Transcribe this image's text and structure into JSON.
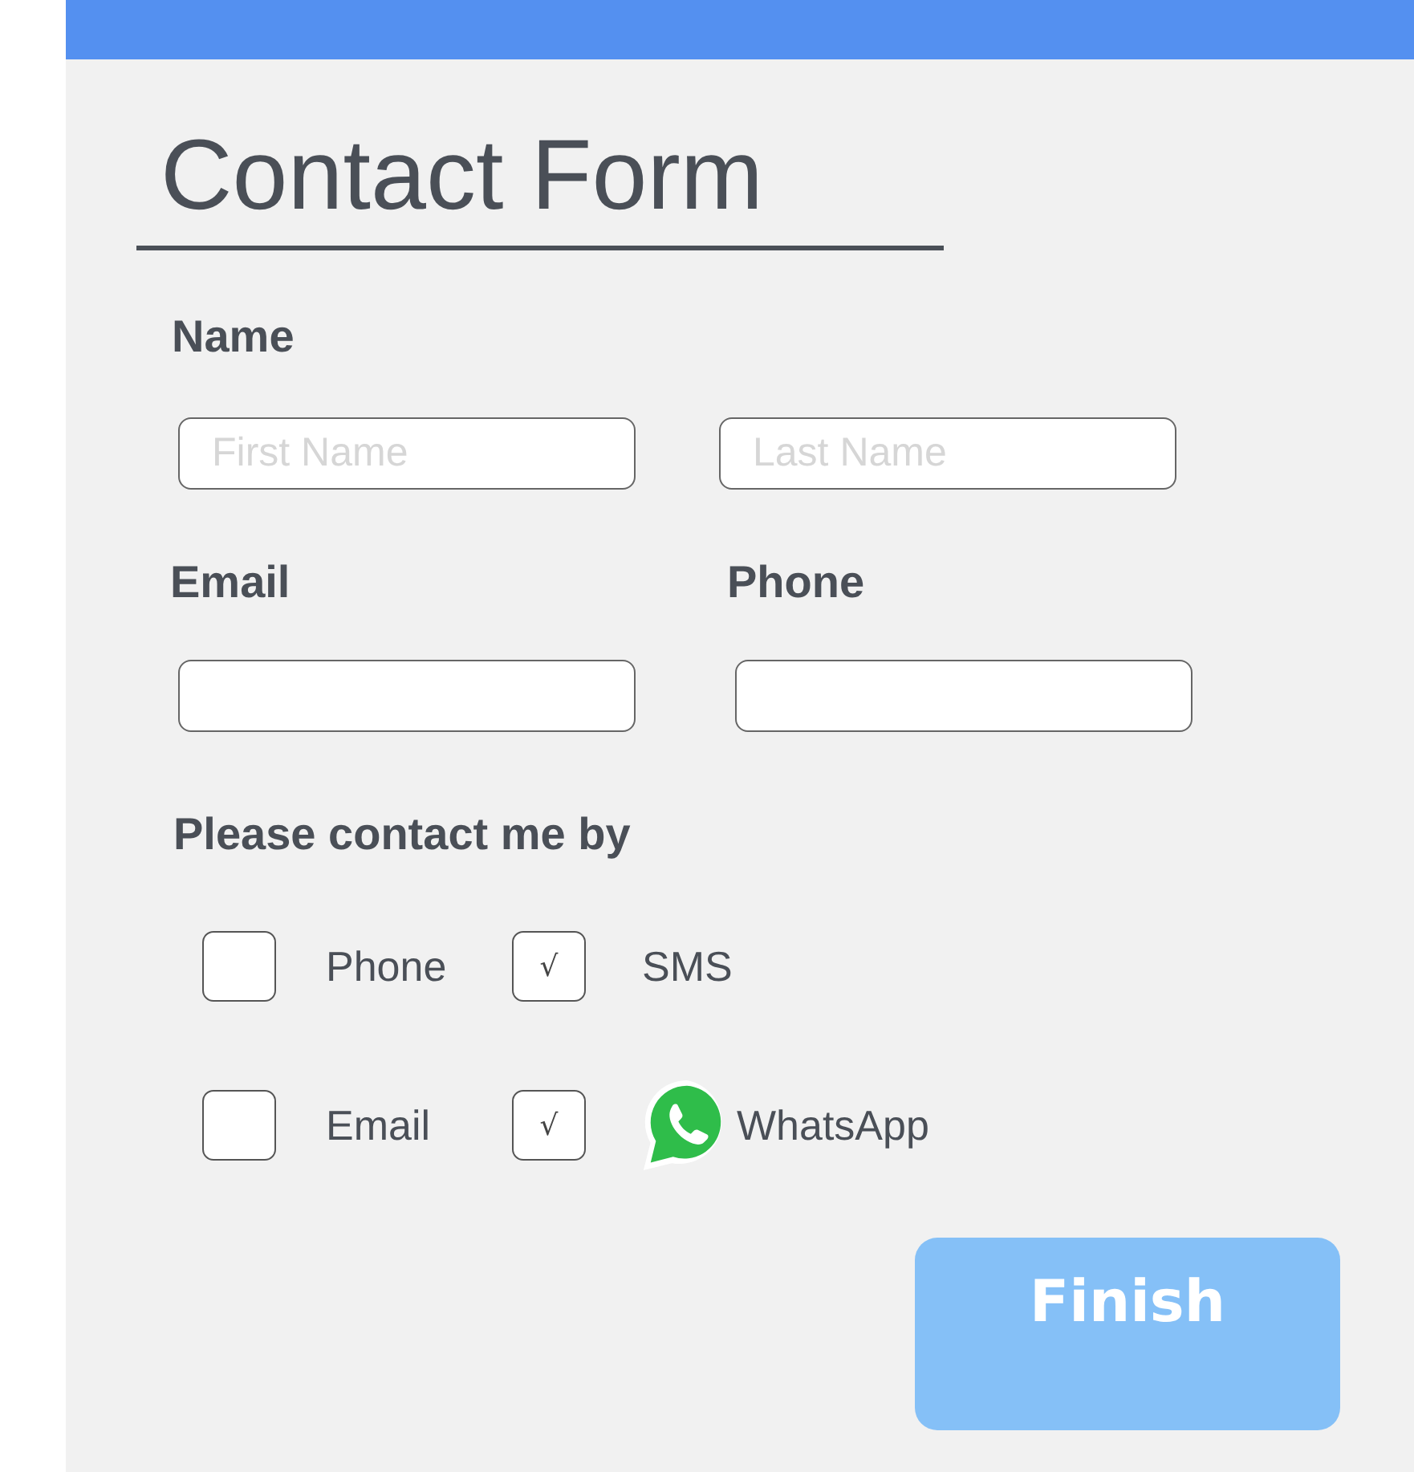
{
  "title": "Contact Form",
  "name": {
    "label": "Name",
    "fields": [
      {
        "placeholder": "First Name"
      },
      {
        "placeholder": "Last Name"
      }
    ]
  },
  "email": {
    "label": "Email"
  },
  "phone": {
    "label": "Phone"
  },
  "contact": {
    "label": "Please contact me by",
    "check_mark": "√",
    "options": [
      {
        "label": "Phone",
        "checked": false,
        "kind": "plain"
      },
      {
        "label": "SMS",
        "checked": true,
        "kind": "plain"
      },
      {
        "label": "Email",
        "checked": false,
        "kind": "plain"
      },
      {
        "label": "WhatsApp",
        "checked": true,
        "kind": "whatsapp"
      }
    ]
  },
  "button": "Finish"
}
